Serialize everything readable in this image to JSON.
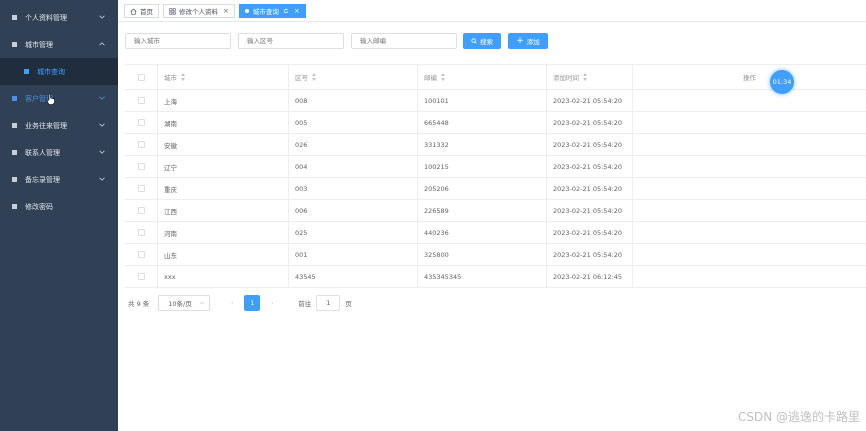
{
  "sidebar": {
    "items": [
      {
        "label": "个人资料管理"
      },
      {
        "label": "城市管理"
      },
      {
        "label": "城市查询"
      },
      {
        "label": "客户管理"
      },
      {
        "label": "业务往来管理"
      },
      {
        "label": "联系人管理"
      },
      {
        "label": "备忘录管理"
      },
      {
        "label": "修改密码"
      }
    ]
  },
  "tabs": [
    {
      "label": "首页"
    },
    {
      "label": "修改个人资料"
    },
    {
      "label": "城市查询"
    }
  ],
  "search": {
    "city_placeholder": "输入城市",
    "district_placeholder": "输入区号",
    "postcode_placeholder": "输入邮编",
    "search_label": "搜索",
    "add_label": "添加"
  },
  "table": {
    "headers": {
      "city": "城市",
      "district": "区号",
      "postcode": "邮编",
      "added_time": "添加时间",
      "actions": "操作"
    },
    "rows": [
      {
        "city": "上海",
        "district": "008",
        "postcode": "100101",
        "added_time": "2023-02-21 05:54:20"
      },
      {
        "city": "湖南",
        "district": "005",
        "postcode": "665448",
        "added_time": "2023-02-21 05:54:20"
      },
      {
        "city": "安徽",
        "district": "026",
        "postcode": "331332",
        "added_time": "2023-02-21 05:54:20"
      },
      {
        "city": "辽宁",
        "district": "004",
        "postcode": "100215",
        "added_time": "2023-02-21 05:54:20"
      },
      {
        "city": "重庆",
        "district": "003",
        "postcode": "205206",
        "added_time": "2023-02-21 05:54:20"
      },
      {
        "city": "江西",
        "district": "006",
        "postcode": "226589",
        "added_time": "2023-02-21 05:54:20"
      },
      {
        "city": "河南",
        "district": "025",
        "postcode": "440236",
        "added_time": "2023-02-21 05:54:20"
      },
      {
        "city": "山东",
        "district": "001",
        "postcode": "325800",
        "added_time": "2023-02-21 05:54:20"
      },
      {
        "city": "xxx",
        "district": "43545",
        "postcode": "435345345",
        "added_time": "2023-02-21 06:12:45"
      }
    ]
  },
  "timer": "01:34",
  "pagination": {
    "total": "共 9 条",
    "page_size": "10条/页",
    "current_page": "1",
    "goto_prefix": "前往",
    "goto_value": "1",
    "goto_suffix": "页"
  },
  "watermark": "CSDN @逃逸的卡路里"
}
